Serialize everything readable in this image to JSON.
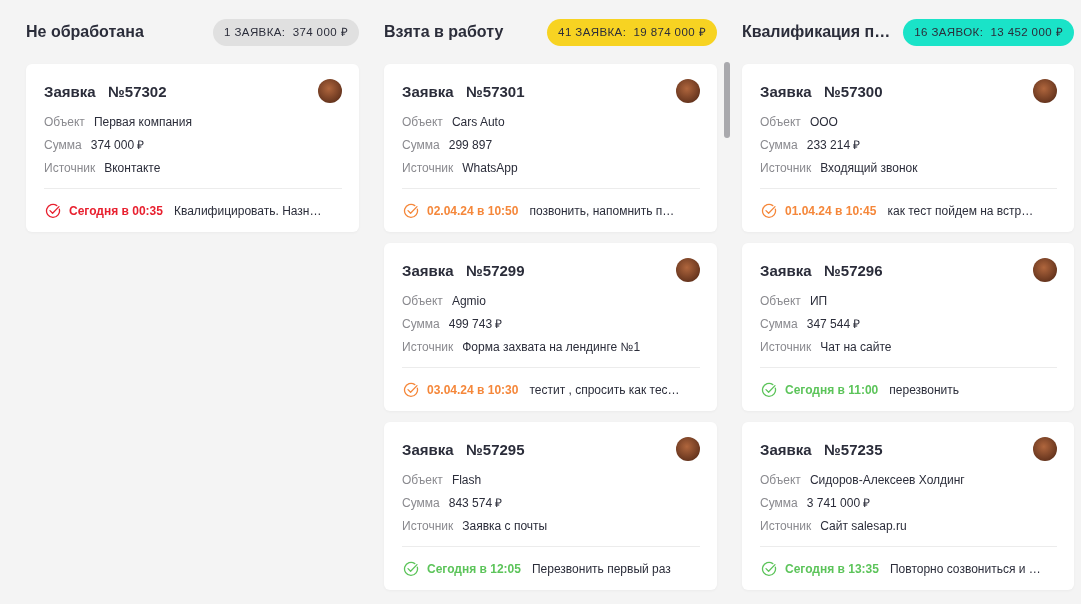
{
  "columns": [
    {
      "title": "Не обработана",
      "badge": "1 ЗАЯВКА:  374 000 ₽",
      "color": "#e0e0e0",
      "scrollbar": false,
      "cards": [
        {
          "title": "Заявка   №57302",
          "fields": [
            {
              "label": "Объект",
              "value": "Первая компания"
            },
            {
              "label": "Сумма",
              "value": "374 000 ₽"
            },
            {
              "label": "Источник",
              "value": "Вконтакте"
            }
          ],
          "task": {
            "color": "#e8202f",
            "time": "Сегодня в 00:35",
            "text": "Квалифицировать. Назн…"
          }
        }
      ]
    },
    {
      "title": "Взята в работу",
      "badge": "41 ЗАЯВКА:  19 874 000 ₽",
      "color": "#f7d322",
      "scrollbar": true,
      "cards": [
        {
          "title": "Заявка   №57301",
          "fields": [
            {
              "label": "Объект",
              "value": "Cars Auto"
            },
            {
              "label": "Сумма",
              "value": "299 897"
            },
            {
              "label": "Источник",
              "value": "WhatsApp"
            }
          ],
          "task": {
            "color": "#f5873a",
            "time": "02.04.24 в 10:50",
            "text": "позвонить, напомнить п…"
          }
        },
        {
          "title": "Заявка   №57299",
          "fields": [
            {
              "label": "Объект",
              "value": "Agmio"
            },
            {
              "label": "Сумма",
              "value": "499 743 ₽"
            },
            {
              "label": "Источник",
              "value": "Форма захвата на лендинге №1"
            }
          ],
          "task": {
            "color": "#f5873a",
            "time": "03.04.24 в 10:30",
            "text": "тестит , спросить как тес…"
          }
        },
        {
          "title": "Заявка   №57295",
          "fields": [
            {
              "label": "Объект",
              "value": "Flash"
            },
            {
              "label": "Сумма",
              "value": "843 574 ₽"
            },
            {
              "label": "Источник",
              "value": "Заявка с почты"
            }
          ],
          "task": {
            "color": "#5cc45a",
            "time": "Сегодня в 12:05",
            "text": "Перезвонить первый раз"
          }
        }
      ]
    },
    {
      "title": "Квалификация п…",
      "badge": "16 ЗАЯВОК:  13 452 000 ₽",
      "color": "#1ae3c8",
      "scrollbar": false,
      "cards": [
        {
          "title": "Заявка   №57300",
          "fields": [
            {
              "label": "Объект",
              "value": "ООО"
            },
            {
              "label": "Сумма",
              "value": "233 214 ₽"
            },
            {
              "label": "Источник",
              "value": "Входящий звонок"
            }
          ],
          "task": {
            "color": "#f5873a",
            "time": "01.04.24 в 10:45",
            "text": "как тест пойдем на встр…"
          }
        },
        {
          "title": "Заявка   №57296",
          "fields": [
            {
              "label": "Объект",
              "value": "ИП"
            },
            {
              "label": "Сумма",
              "value": "347 544 ₽"
            },
            {
              "label": "Источник",
              "value": "Чат на сайте"
            }
          ],
          "task": {
            "color": "#5cc45a",
            "time": "Сегодня в 11:00",
            "text": "перезвонить"
          }
        },
        {
          "title": "Заявка   №57235",
          "fields": [
            {
              "label": "Объект",
              "value": "Сидоров-Алексеев Холдинг"
            },
            {
              "label": "Сумма",
              "value": "3 741 000 ₽"
            },
            {
              "label": "Источник",
              "value": "Сайт salesap.ru"
            }
          ],
          "task": {
            "color": "#5cc45a",
            "time": "Сегодня в 13:35",
            "text": "Повторно созвониться и …"
          }
        }
      ]
    }
  ]
}
